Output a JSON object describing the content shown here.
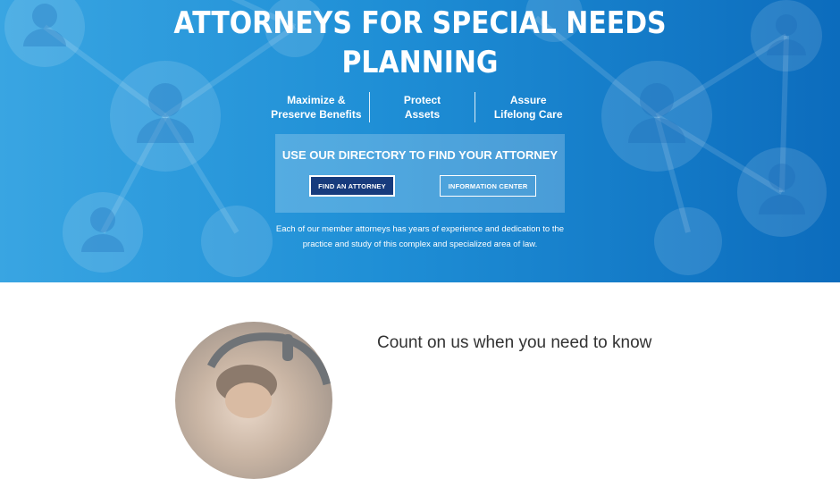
{
  "hero": {
    "title_line1": "ATTORNEYS FOR SPECIAL NEEDS",
    "title_line2": "PLANNING",
    "pillars": [
      {
        "line1": "Maximize &",
        "line2": "Preserve Benefits"
      },
      {
        "line1": "Protect",
        "line2": "Assets"
      },
      {
        "line1": "Assure",
        "line2": "Lifelong Care"
      }
    ],
    "directory": {
      "heading": "USE OUR DIRECTORY TO FIND YOUR ATTORNEY",
      "find_button": "FIND AN ATTORNEY",
      "info_button": "INFORMATION CENTER"
    },
    "description_line1": "Each of our member attorneys has years of experience and dedication to the",
    "description_line2": "practice and study of this complex and specialized area of law."
  },
  "section": {
    "heading": "Count on us when you need to know"
  },
  "colors": {
    "hero_gradient_start": "#39a5e2",
    "hero_gradient_end": "#0c6cbd",
    "find_button_bg": "#173b7d",
    "heading_text": "#333333"
  },
  "icons": {
    "background": "person-network-icon",
    "photo": "person-photo"
  }
}
